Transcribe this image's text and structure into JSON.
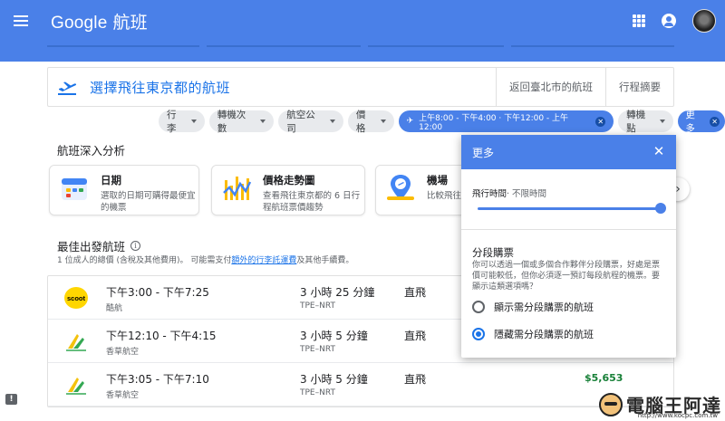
{
  "appbar": {
    "brand": "Google",
    "product": "航班"
  },
  "header": {
    "title": "選擇飛往東京都的航班",
    "links": [
      "返回臺北市的航班",
      "行程摘要"
    ]
  },
  "filters": [
    {
      "label": "行李",
      "active": false
    },
    {
      "label": "轉機次數",
      "active": false
    },
    {
      "label": "航空公司",
      "active": false
    },
    {
      "label": "價格",
      "active": false
    },
    {
      "label": "上午8:00 - 下午4:00 · 下午12:00 - 上午12:00",
      "active": true
    },
    {
      "label": "轉機點",
      "active": false
    },
    {
      "label": "更多",
      "active": true
    }
  ],
  "insights": {
    "title": "航班深入分析",
    "cards": [
      {
        "head": "日期",
        "desc": "選取的日期可購得最便宜的機票"
      },
      {
        "head": "價格走勢圖",
        "desc": "查看飛往東京都的 6 日行程航班票價趨勢"
      },
      {
        "head": "機場",
        "desc": "比較飛往東京都的航班票價"
      }
    ]
  },
  "best": {
    "title": "最佳出發航班",
    "note_prefix": "1 位成人的總價 (含稅及其他費用)。 可能需支付",
    "note_link": "額外的行李託運費",
    "note_suffix": "及其他手續費。"
  },
  "flights": [
    {
      "times": "下午3:00 - 下午7:25",
      "airline": "酷航",
      "duration": "3 小時 25 分鐘",
      "route": "TPE–NRT",
      "stops": "直飛",
      "price": "",
      "logo": "scoot"
    },
    {
      "times": "下午12:10 - 下午4:15",
      "airline": "香草航空",
      "duration": "3 小時 5 分鐘",
      "route": "TPE–NRT",
      "stops": "直飛",
      "price": "",
      "logo": "vanilla"
    },
    {
      "times": "下午3:05 - 下午7:10",
      "airline": "香草航空",
      "duration": "3 小時 5 分鐘",
      "route": "TPE–NRT",
      "stops": "直飛",
      "price": "$5,653",
      "logo": "vanilla"
    }
  ],
  "scoot_logo_text": "scoot",
  "dialog": {
    "title": "更多",
    "flight_time_label": "飛行時間",
    "flight_time_value": "· 不限時間",
    "split_title": "分段購票",
    "split_desc": "你可以透過一個或多個合作夥伴分段購票，好處是票價可能較低，但你必須逐一預訂每段航程的機票。要顯示這類選項嗎？",
    "options": [
      {
        "label": "顯示需分段購票的航班",
        "selected": false
      },
      {
        "label": "隱藏需分段購票的航班",
        "selected": true
      }
    ]
  },
  "watermark": {
    "text": "電腦王阿達",
    "url": "http://www.kocpc.com.tw"
  },
  "colors": {
    "primary": "#4a80e8",
    "link": "#1a73e8",
    "price": "#188038"
  }
}
